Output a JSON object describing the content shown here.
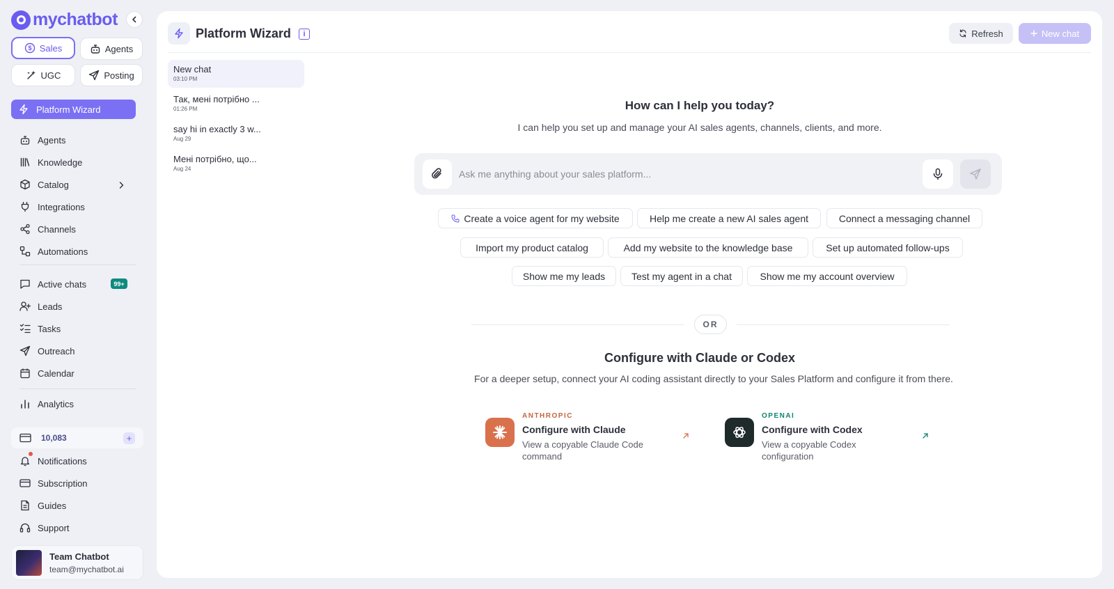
{
  "brand": {
    "name": "mychatbot",
    "accent": "#6a5cf0"
  },
  "modes": [
    {
      "label": "Sales",
      "icon": "dollar-circle-icon",
      "active": true
    },
    {
      "label": "Agents",
      "icon": "robot-icon",
      "active": false
    },
    {
      "label": "UGC",
      "icon": "sparkle-wand-icon",
      "active": false
    },
    {
      "label": "Posting",
      "icon": "send-icon",
      "active": false
    }
  ],
  "sidebar": {
    "wizard_label": "Platform Wizard",
    "nav_group_1": [
      "Agents",
      "Knowledge",
      "Catalog",
      "Integrations",
      "Channels",
      "Automations"
    ],
    "nav_group_2": [
      "Active chats",
      "Leads",
      "Tasks",
      "Outreach",
      "Calendar"
    ],
    "active_chats_badge": "99+",
    "analytics_label": "Analytics",
    "credits": "10,083",
    "credits_add": "+",
    "nav_group_3": [
      "Notifications",
      "Subscription",
      "Guides",
      "Support"
    ],
    "user": {
      "name": "Team Chatbot",
      "email": "team@mychatbot.ai"
    }
  },
  "header": {
    "title": "Platform Wizard",
    "info": "i",
    "refresh_label": "Refresh",
    "new_chat_label": "New chat"
  },
  "history": [
    {
      "title": "New chat",
      "time": "03:10 PM",
      "active": true
    },
    {
      "title": "Так, мені потрібно ...",
      "time": "01:26 PM",
      "active": false
    },
    {
      "title": "say hi in exactly 3 w...",
      "time": "Aug 29",
      "active": false
    },
    {
      "title": "Мені потрібно, що...",
      "time": "Aug 24",
      "active": false
    }
  ],
  "hero": {
    "title": "How can I help you today?",
    "subtitle": "I can help you set up and manage your AI sales agents, channels, clients, and more."
  },
  "composer": {
    "placeholder": "Ask me anything about your sales platform...",
    "value": ""
  },
  "suggestions": [
    [
      "Create a voice agent for my website",
      "Help me create a new AI sales agent",
      "Connect a messaging channel"
    ],
    [
      "Import my product catalog",
      "Add my website to the knowledge base",
      "Set up automated follow-ups"
    ],
    [
      "Show me my leads",
      "Test my agent in a chat",
      "Show me my account overview"
    ]
  ],
  "divider_label": "OR",
  "configure": {
    "title": "Configure with Claude or Codex",
    "subtitle": "For a deeper setup, connect your AI coding assistant directly to your Sales Platform and configure it from there.",
    "providers": [
      {
        "brand": "ANTHROPIC",
        "title": "Configure with Claude",
        "desc": "View a copyable Claude Code command",
        "color": "#c2663f",
        "icon_bg": "#d9714c"
      },
      {
        "brand": "OPENAI",
        "title": "Configure with Codex",
        "desc": "View a copyable Codex configuration",
        "color": "#10846e",
        "icon_bg": "#1f2a2a"
      }
    ]
  }
}
